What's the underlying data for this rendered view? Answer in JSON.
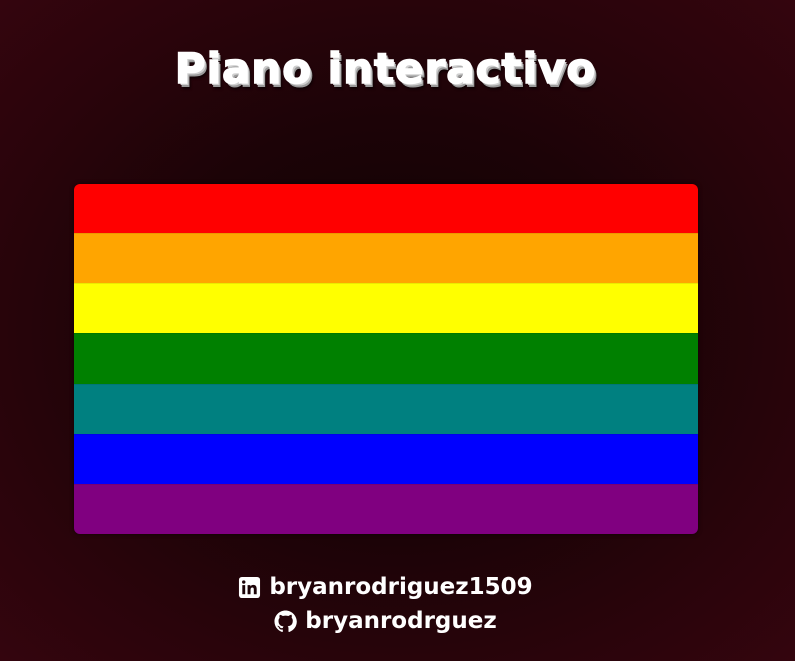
{
  "page": {
    "title": "Piano interactivo"
  },
  "piano": {
    "keys": [
      {
        "name": "key-red",
        "color": "#ff0000"
      },
      {
        "name": "key-orange",
        "color": "#ffa500"
      },
      {
        "name": "key-yellow",
        "color": "#ffff00"
      },
      {
        "name": "key-green",
        "color": "#008000"
      },
      {
        "name": "key-teal",
        "color": "#008080"
      },
      {
        "name": "key-blue",
        "color": "#0000ff"
      },
      {
        "name": "key-purple",
        "color": "#800080"
      }
    ]
  },
  "footer": {
    "linkedin": {
      "icon": "linkedin-icon",
      "label": "bryanrodriguez1509"
    },
    "github": {
      "icon": "github-icon",
      "label": "bryanrodrguez"
    }
  }
}
